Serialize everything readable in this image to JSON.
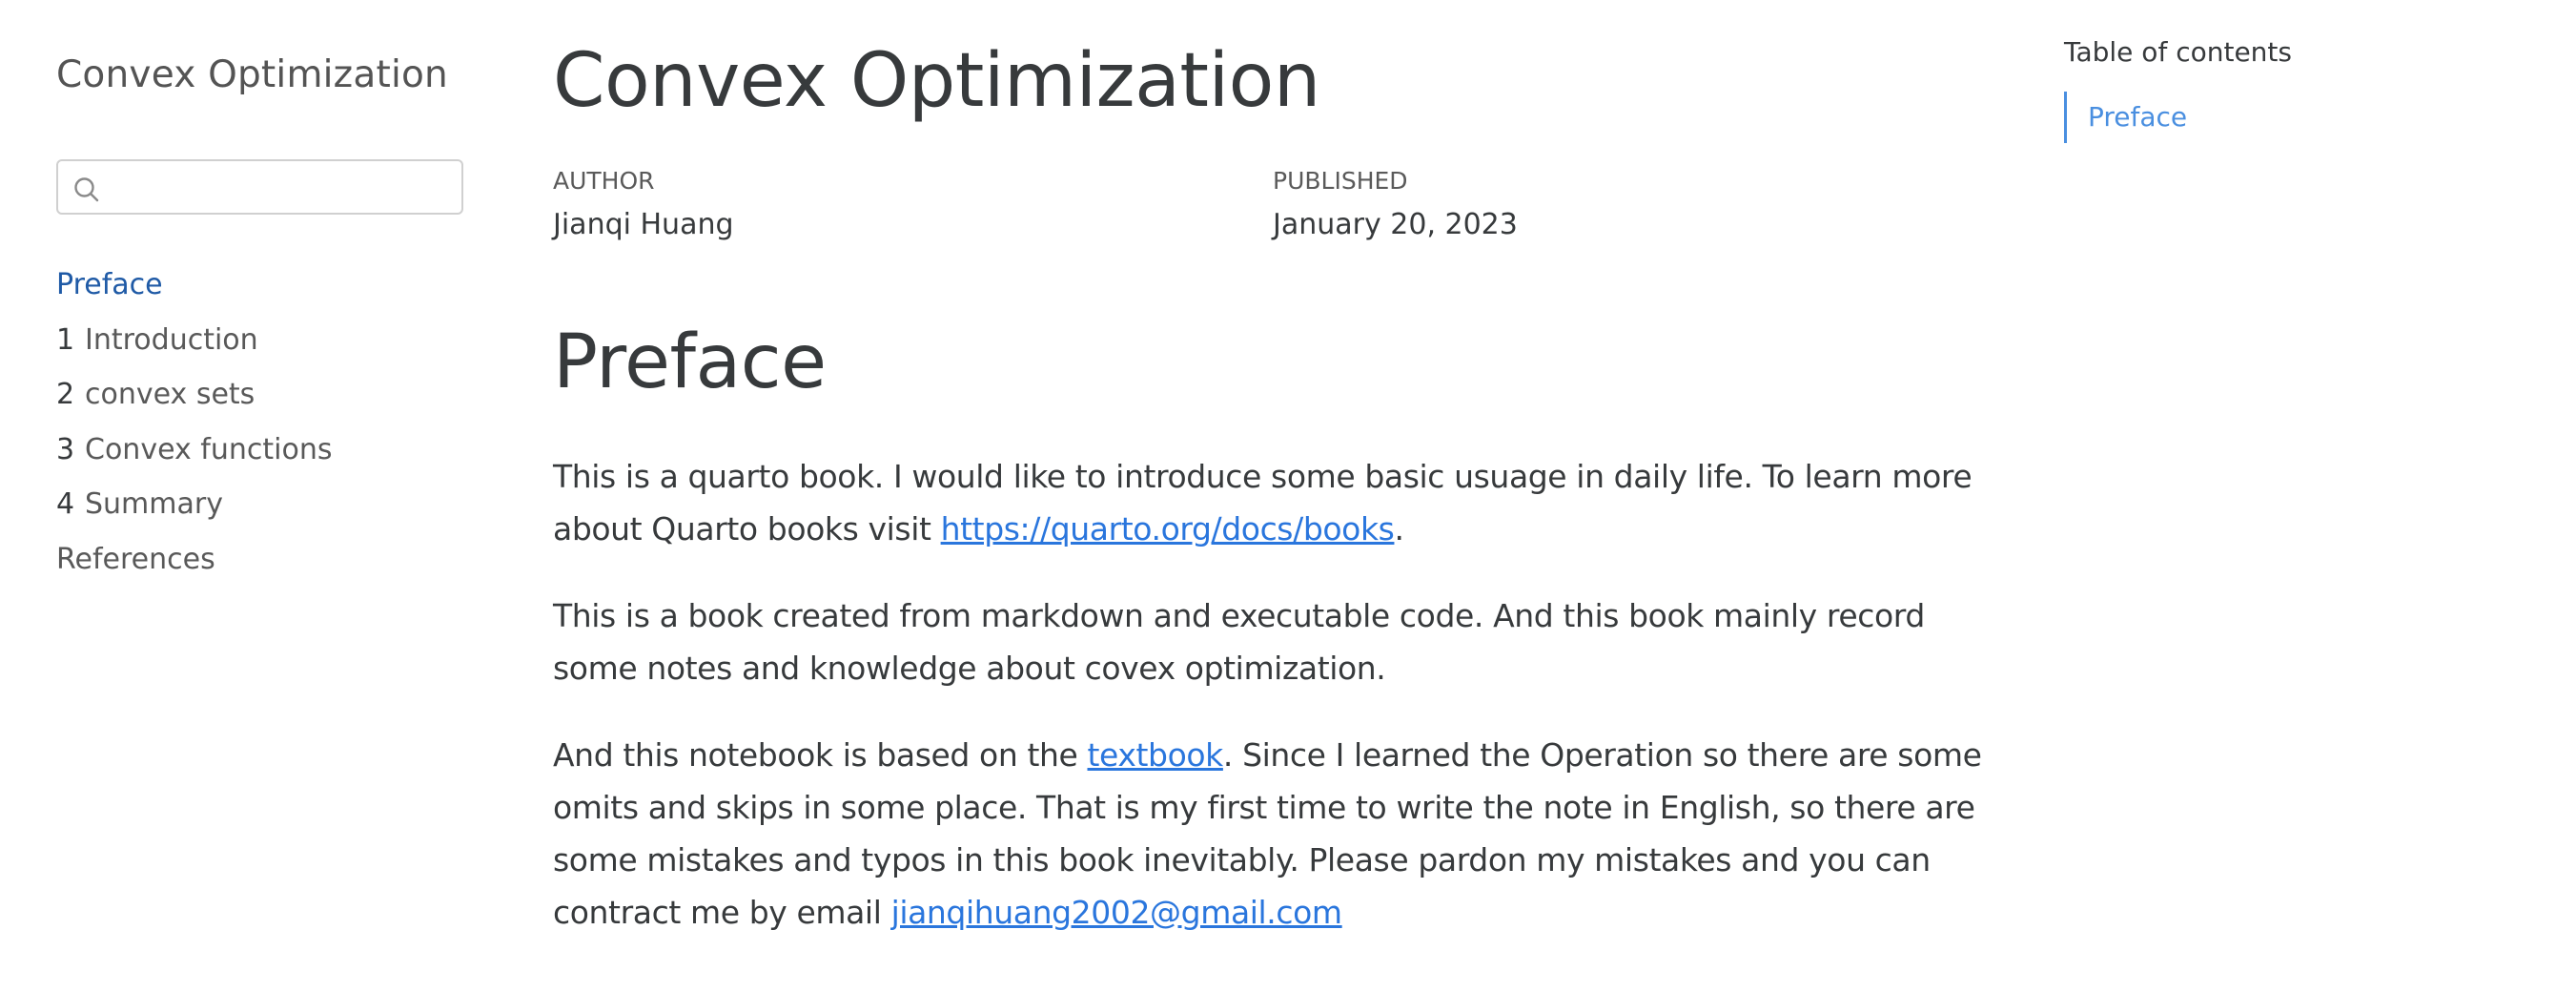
{
  "sidebar": {
    "title": "Convex Optimization",
    "search": {
      "value": "",
      "placeholder": ""
    },
    "items": [
      {
        "num": "",
        "label": "Preface",
        "active": true
      },
      {
        "num": "1",
        "label": "Introduction"
      },
      {
        "num": "2",
        "label": "convex sets"
      },
      {
        "num": "3",
        "label": "Convex functions"
      },
      {
        "num": "4",
        "label": "Summary"
      },
      {
        "num": "",
        "label": "References"
      }
    ]
  },
  "main": {
    "title": "Convex Optimization",
    "author_label": "AUTHOR",
    "author": "Jianqi Huang",
    "published_label": "PUBLISHED",
    "published": "January 20, 2023",
    "section_heading": "Preface",
    "para1": {
      "text_before": "This is a quarto book. I would like to introduce some basic usuage in daily life. To learn more about Quarto books visit ",
      "link": "https://quarto.org/docs/books",
      "text_after": "."
    },
    "para2": {
      "text": "This is a book created from markdown and executable code. And this book mainly record some notes and knowledge about covex optimization."
    },
    "para3": {
      "text_before": "And this notebook is based on the ",
      "link": "textbook",
      "text_middle": ". Since I learned the Operation so there are some omits and skips in some place. That is my first time to write the note in English, so there are some mistakes and typos in this book inevitably. Please pardon my mistakes and you can contract me by email ",
      "email": "jianqihuang2002@gmail.com"
    }
  },
  "toc": {
    "title": "Table of contents",
    "items": [
      {
        "label": "Preface"
      }
    ]
  },
  "colors": {
    "text": "#373a3c",
    "link": "#2a76dd",
    "active_nav": "#1f5aa6",
    "toc_accent": "#4a8fe0"
  },
  "icons": {
    "search": "search-icon"
  }
}
